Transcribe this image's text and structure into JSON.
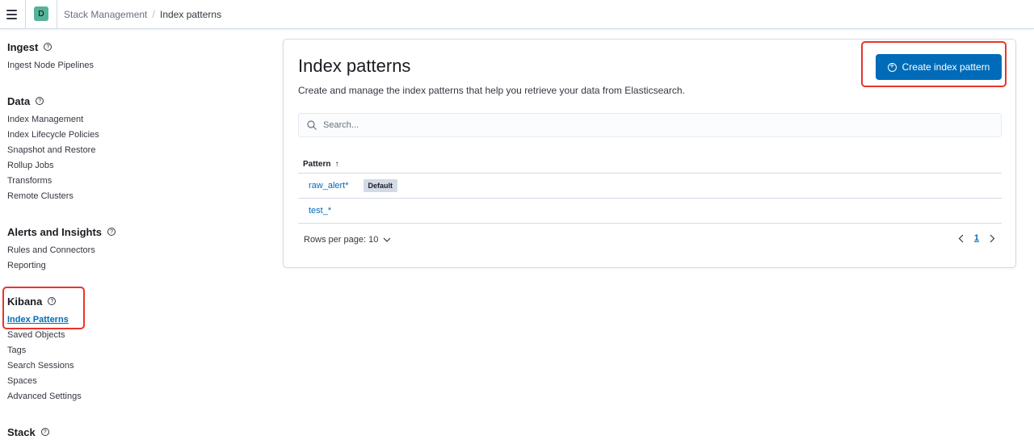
{
  "header": {
    "space_initial": "D",
    "breadcrumbs": [
      "Stack Management",
      "Index patterns"
    ]
  },
  "sidebar": {
    "groups": [
      {
        "title": "Ingest",
        "items": [
          "Ingest Node Pipelines"
        ]
      },
      {
        "title": "Data",
        "items": [
          "Index Management",
          "Index Lifecycle Policies",
          "Snapshot and Restore",
          "Rollup Jobs",
          "Transforms",
          "Remote Clusters"
        ]
      },
      {
        "title": "Alerts and Insights",
        "items": [
          "Rules and Connectors",
          "Reporting"
        ]
      },
      {
        "title": "Kibana",
        "items": [
          "Index Patterns",
          "Saved Objects",
          "Tags",
          "Search Sessions",
          "Spaces",
          "Advanced Settings"
        ]
      },
      {
        "title": "Stack",
        "items": []
      }
    ],
    "active_item": "Index Patterns"
  },
  "main": {
    "title": "Index patterns",
    "description": "Create and manage the index patterns that help you retrieve your data from Elasticsearch.",
    "create_button": "Create index pattern",
    "search_placeholder": "Search...",
    "table": {
      "column_header": "Pattern",
      "rows": [
        {
          "pattern": "raw_alert*",
          "badge": "Default"
        },
        {
          "pattern": "test_*",
          "badge": ""
        }
      ]
    },
    "rows_per_page": "Rows per page: 10",
    "current_page": "1"
  },
  "colors": {
    "primary": "#006bb8",
    "highlight": "#e7352b",
    "space_avatar": "#54b399"
  }
}
